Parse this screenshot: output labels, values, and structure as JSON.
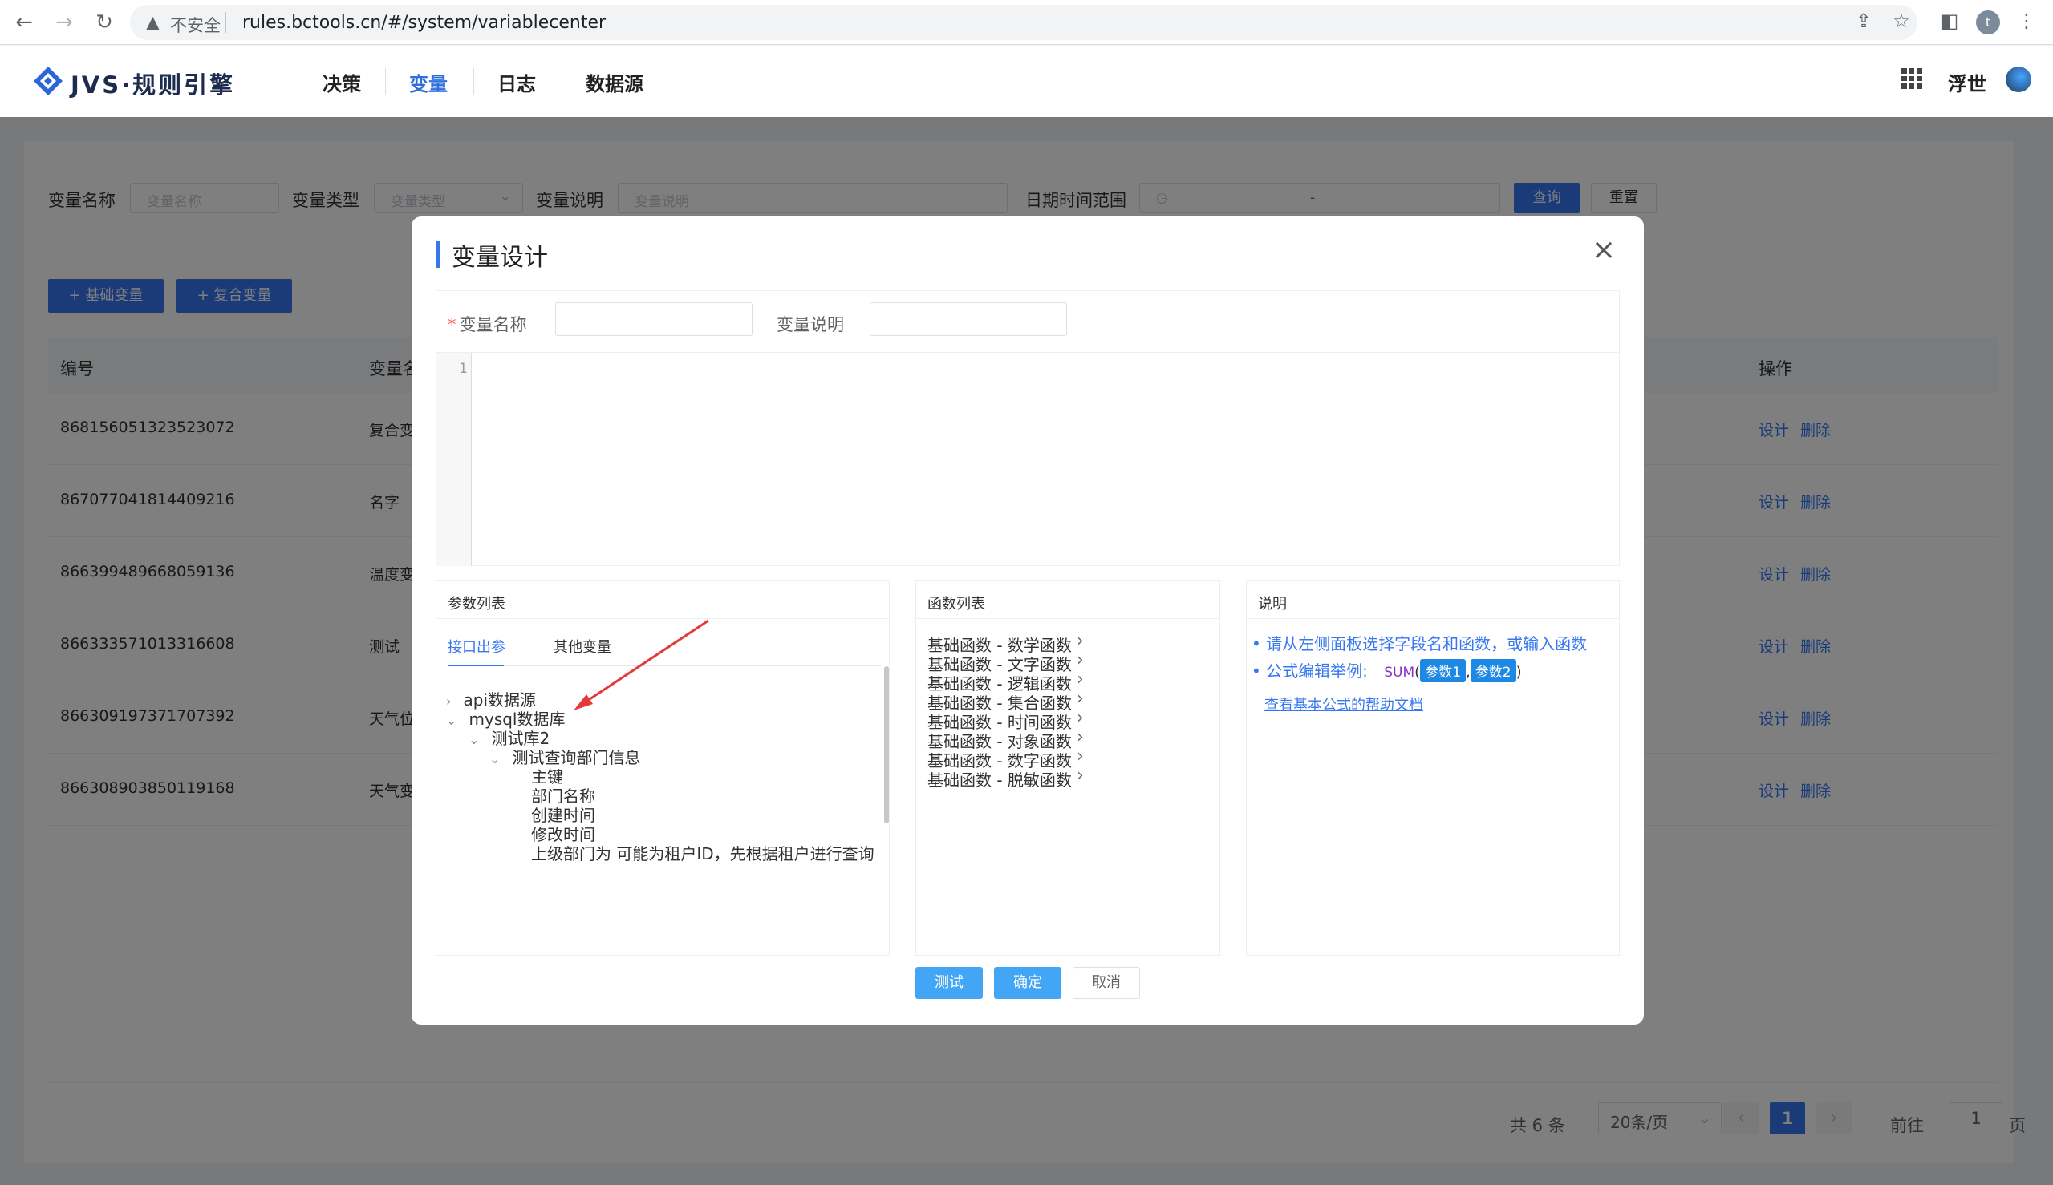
{
  "browser": {
    "insecure_label": "不安全",
    "url": "rules.bctools.cn/#/system/variablecenter",
    "profile_initial": "t"
  },
  "header": {
    "logo_text": "JVS·规则引擎",
    "nav": [
      "决策",
      "变量",
      "日志",
      "数据源"
    ],
    "active_nav": "变量",
    "user_name": "浮世"
  },
  "filters": {
    "name_label": "变量名称",
    "name_placeholder": "变量名称",
    "type_label": "变量类型",
    "type_placeholder": "变量类型",
    "desc_label": "变量说明",
    "desc_placeholder": "变量说明",
    "date_label": "日期时间范围",
    "date_separator": "-",
    "query_button": "查询",
    "reset_button": "重置"
  },
  "actions": {
    "add_basic": "+ 基础变量",
    "add_composite": "+ 复合变量"
  },
  "table": {
    "headers": [
      "编号",
      "变量名称",
      "操作"
    ],
    "rows": [
      {
        "id": "868156051323523072",
        "name": "复合变量"
      },
      {
        "id": "867077041814409216",
        "name": "名字"
      },
      {
        "id": "866399489668059136",
        "name": "温度变量"
      },
      {
        "id": "866333571013316608",
        "name": "测试"
      },
      {
        "id": "866309197371707392",
        "name": "天气位置"
      },
      {
        "id": "866308903850119168",
        "name": "天气变量"
      }
    ],
    "design_label": "设计",
    "delete_label": "删除"
  },
  "pagination": {
    "total": "共 6 条",
    "page_size": "20条/页",
    "current_page": "1",
    "goto_prefix": "前往",
    "goto_value": "1",
    "goto_suffix": "页"
  },
  "dialog": {
    "title": "变量设计",
    "name_label": "变量名称",
    "desc_label": "变量说明",
    "editor_line": "1",
    "params_panel": {
      "title": "参数列表",
      "tabs": [
        "接口出参",
        "其他变量"
      ],
      "tree": [
        {
          "label": "api数据源",
          "level": 0,
          "arrow": "›"
        },
        {
          "label": "mysql数据库",
          "level": 0,
          "arrow": "⌄"
        },
        {
          "label": "测试库2",
          "level": 1,
          "arrow": "⌄"
        },
        {
          "label": "测试查询部门信息",
          "level": 2,
          "arrow": "⌄"
        },
        {
          "label": "主键",
          "level": 3,
          "arrow": ""
        },
        {
          "label": "部门名称",
          "level": 3,
          "arrow": ""
        },
        {
          "label": "创建时间",
          "level": 3,
          "arrow": ""
        },
        {
          "label": "修改时间",
          "level": 3,
          "arrow": ""
        },
        {
          "label": "上级部门为 可能为租户ID，先根据租户进行查询",
          "level": 3,
          "arrow": ""
        }
      ]
    },
    "functions_panel": {
      "title": "函数列表",
      "items": [
        "基础函数 - 数学函数",
        "基础函数 - 文字函数",
        "基础函数 - 逻辑函数",
        "基础函数 - 集合函数",
        "基础函数 - 时间函数",
        "基础函数 - 对象函数",
        "基础函数 - 数字函数",
        "基础函数 - 脱敏函数"
      ]
    },
    "description_panel": {
      "title": "说明",
      "line1": "请从左侧面板选择字段名和函数，或输入函数",
      "line2_prefix": "公式编辑举例:",
      "sum": "SUM",
      "param1": "参数1",
      "param2": "参数2",
      "help_link": "查看基本公式的帮助文档"
    },
    "buttons": {
      "test": "测试",
      "ok": "确定",
      "cancel": "取消"
    }
  },
  "colors": {
    "accent": "#3677f0",
    "dialog_button": "#42a5f5",
    "annotation_arrow": "#e53935"
  }
}
